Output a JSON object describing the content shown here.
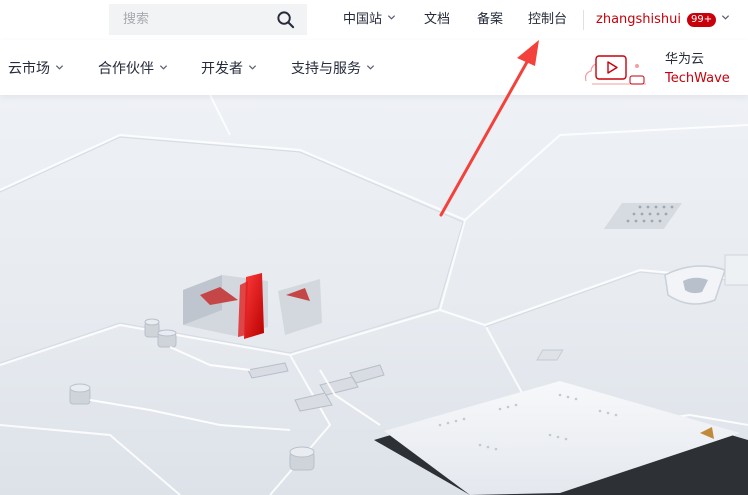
{
  "search": {
    "placeholder": "搜索"
  },
  "topbar": {
    "region": "中国站",
    "docs": "文档",
    "filing": "备案",
    "console": "控制台",
    "username": "zhangshishui",
    "badge": "99+"
  },
  "nav": {
    "items": [
      {
        "label": "云市场"
      },
      {
        "label": "合作伙伴"
      },
      {
        "label": "开发者"
      },
      {
        "label": "支持与服务"
      }
    ]
  },
  "promo": {
    "line1": "华为云",
    "line2": "TechWave"
  },
  "colors": {
    "brand_red": "#c7000b",
    "arrow_red": "#f2423b",
    "text": "#252b3a"
  },
  "annotation": {
    "type": "arrow",
    "target": "控制台"
  }
}
